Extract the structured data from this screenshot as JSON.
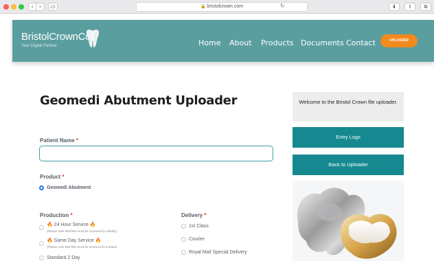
{
  "browser": {
    "url": "bristolcrown.com",
    "back_glyph": "‹",
    "forward_glyph": "›",
    "sidebar_glyph": "▭",
    "reload_glyph": "↻",
    "lock_glyph": "🔒",
    "right_buttons": [
      "⬇",
      "⇧",
      "⧉"
    ]
  },
  "header": {
    "brand": "BristolCrownCo",
    "tagline": "Your Digital Partner",
    "background": "#5b9ea0",
    "nav": [
      "Home",
      "About",
      "Products",
      "Documents",
      "Contact"
    ],
    "cta_label": "UPLOADER",
    "cta_color": "#f28a1e"
  },
  "main": {
    "title": "Geomedi Abutment Uploader",
    "patient_name_label": "Patient Name",
    "required_marker": "*",
    "product_label": "Product",
    "product_options": [
      "Geomedi Abutment"
    ],
    "production_label": "Production",
    "production_options": [
      {
        "label": "24 Hour Service",
        "note": "(Please note that files must be received by midday)"
      },
      {
        "label": "Same Day Service",
        "note": "(Please note that files must be received by 9:30am)"
      },
      {
        "label": "Standard 2 Day",
        "note": ""
      }
    ],
    "delivery_label": "Delivery",
    "delivery_options": [
      "1st Class",
      "Courier",
      "Royal Mail Special Delivery"
    ],
    "fire_glyph": "🔥"
  },
  "sidebar": {
    "welcome": "Welcome to the Bristol Crown file uploader.",
    "entry_logs": "Entry Logs",
    "back_to_uploader": "Back to Uploader",
    "button_color": "#15898f"
  }
}
